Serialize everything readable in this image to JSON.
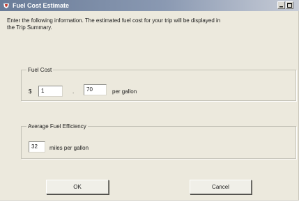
{
  "window": {
    "title": "Fuel Cost Estimate",
    "minimize_icon": "minimize-icon",
    "maximize_icon": "maximize-icon"
  },
  "intro_line1": "Enter the following information.  The estimated fuel cost for your trip will be displayed in",
  "intro_line2": "the Trip Summary.",
  "fuel_cost": {
    "group_label": "Fuel Cost",
    "currency_symbol": "$",
    "dollars_value": "1",
    "separator": ".",
    "cents_value": "70",
    "unit_label": "per gallon"
  },
  "fuel_efficiency": {
    "group_label": "Average Fuel Efficiency",
    "mpg_value": "32",
    "unit_label": "miles per gallon"
  },
  "buttons": {
    "ok_label": "OK",
    "cancel_label": "Cancel"
  },
  "colors": {
    "dialog_background": "#ece9dd",
    "titlebar_start": "#6a7c98",
    "titlebar_end": "#c7ccd6"
  }
}
